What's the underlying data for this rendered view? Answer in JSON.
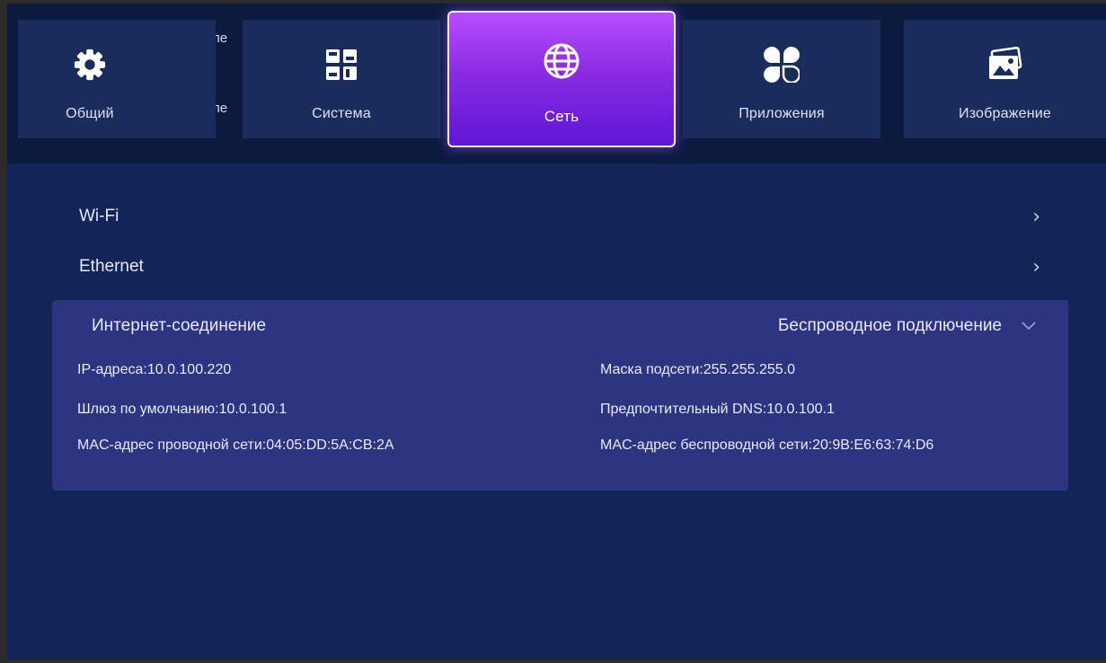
{
  "tabs": [
    {
      "label": "Общий",
      "icon": "gear-icon"
    },
    {
      "label": "Система",
      "icon": "grid-icon"
    },
    {
      "label": "Сеть",
      "icon": "globe-icon",
      "active": true
    },
    {
      "label": "Приложения",
      "icon": "apps-icon"
    },
    {
      "label": "Изображение",
      "icon": "picture-icon"
    }
  ],
  "ghost_text": [
    "ле",
    "ле"
  ],
  "network": {
    "items": [
      {
        "label": "Wi-Fi"
      },
      {
        "label": "Ethernet"
      }
    ],
    "connection": {
      "label": "Интернет-соединение",
      "value": "Беспроводное подключение",
      "details": {
        "ip": "IP-адреса:10.0.100.220",
        "mask": "Маска подсети:255.255.255.0",
        "gateway": "Шлюз по умолчанию:10.0.100.1",
        "dns": "Предпочтительный DNS:10.0.100.1",
        "mac_wired": "MAC-адрес проводной сети:04:05:DD:5A:CB:2A",
        "mac_wireless": "MAC-адрес беспроводной сети:20:9B:E6:63:74:D6"
      }
    }
  },
  "colors": {
    "background": "#0c1a40",
    "panel": "#122458",
    "tab": "#1a2c5c",
    "active_tab_top": "#b84dff",
    "active_tab_bottom": "#5e17d6",
    "expanded_row": "#2d3480"
  }
}
